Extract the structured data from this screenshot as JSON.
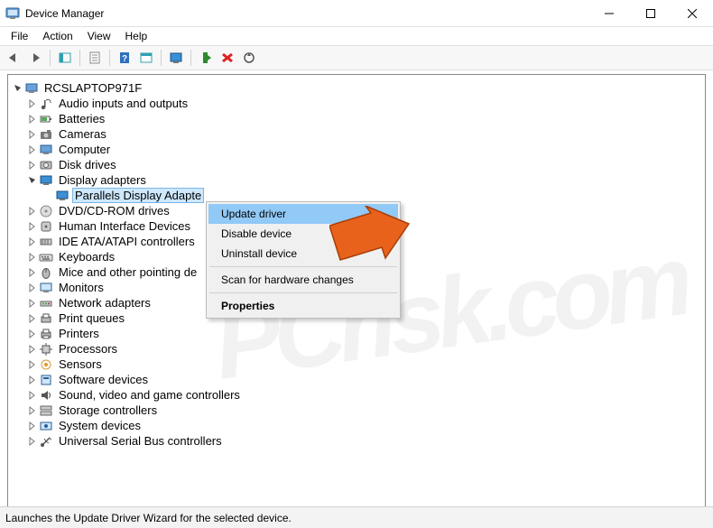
{
  "window": {
    "title": "Device Manager",
    "minimize": "–",
    "maximize": "☐",
    "close": "✕"
  },
  "menu": {
    "file": "File",
    "action": "Action",
    "view": "View",
    "help": "Help"
  },
  "root": {
    "name": "RCSLAPTOP971F"
  },
  "categories": [
    {
      "icon": "audio-icon",
      "label": "Audio inputs and outputs",
      "expanded": false
    },
    {
      "icon": "battery-icon",
      "label": "Batteries",
      "expanded": false
    },
    {
      "icon": "camera-icon",
      "label": "Cameras",
      "expanded": false
    },
    {
      "icon": "computer-icon",
      "label": "Computer",
      "expanded": false
    },
    {
      "icon": "disk-icon",
      "label": "Disk drives",
      "expanded": false
    },
    {
      "icon": "display-icon",
      "label": "Display adapters",
      "expanded": true,
      "children": [
        {
          "icon": "display-icon",
          "label": "Parallels Display Adapte",
          "selected": true
        }
      ]
    },
    {
      "icon": "dvd-icon",
      "label": "DVD/CD-ROM drives",
      "expanded": false
    },
    {
      "icon": "hid-icon",
      "label": "Human Interface Devices",
      "expanded": false
    },
    {
      "icon": "ide-icon",
      "label": "IDE ATA/ATAPI controllers",
      "expanded": false
    },
    {
      "icon": "keyboard-icon",
      "label": "Keyboards",
      "expanded": false
    },
    {
      "icon": "mouse-icon",
      "label": "Mice and other pointing de",
      "expanded": false
    },
    {
      "icon": "monitor-icon",
      "label": "Monitors",
      "expanded": false
    },
    {
      "icon": "network-icon",
      "label": "Network adapters",
      "expanded": false
    },
    {
      "icon": "printqueue-icon",
      "label": "Print queues",
      "expanded": false
    },
    {
      "icon": "printer-icon",
      "label": "Printers",
      "expanded": false
    },
    {
      "icon": "cpu-icon",
      "label": "Processors",
      "expanded": false
    },
    {
      "icon": "sensor-icon",
      "label": "Sensors",
      "expanded": false
    },
    {
      "icon": "software-icon",
      "label": "Software devices",
      "expanded": false
    },
    {
      "icon": "sound-icon",
      "label": "Sound, video and game controllers",
      "expanded": false
    },
    {
      "icon": "storage-icon",
      "label": "Storage controllers",
      "expanded": false
    },
    {
      "icon": "system-icon",
      "label": "System devices",
      "expanded": false
    },
    {
      "icon": "usb-icon",
      "label": "Universal Serial Bus controllers",
      "expanded": false
    }
  ],
  "context_menu": {
    "items": [
      {
        "label": "Update driver",
        "highlight": true
      },
      {
        "label": "Disable device",
        "highlight": false
      },
      {
        "label": "Uninstall device",
        "highlight": false
      },
      {
        "sep": true
      },
      {
        "label": "Scan for hardware changes",
        "highlight": false
      },
      {
        "sep": true
      },
      {
        "label": "Properties",
        "bold": true,
        "highlight": false
      }
    ]
  },
  "status": "Launches the Update Driver Wizard for the selected device.",
  "watermark": "PCrisk.com"
}
